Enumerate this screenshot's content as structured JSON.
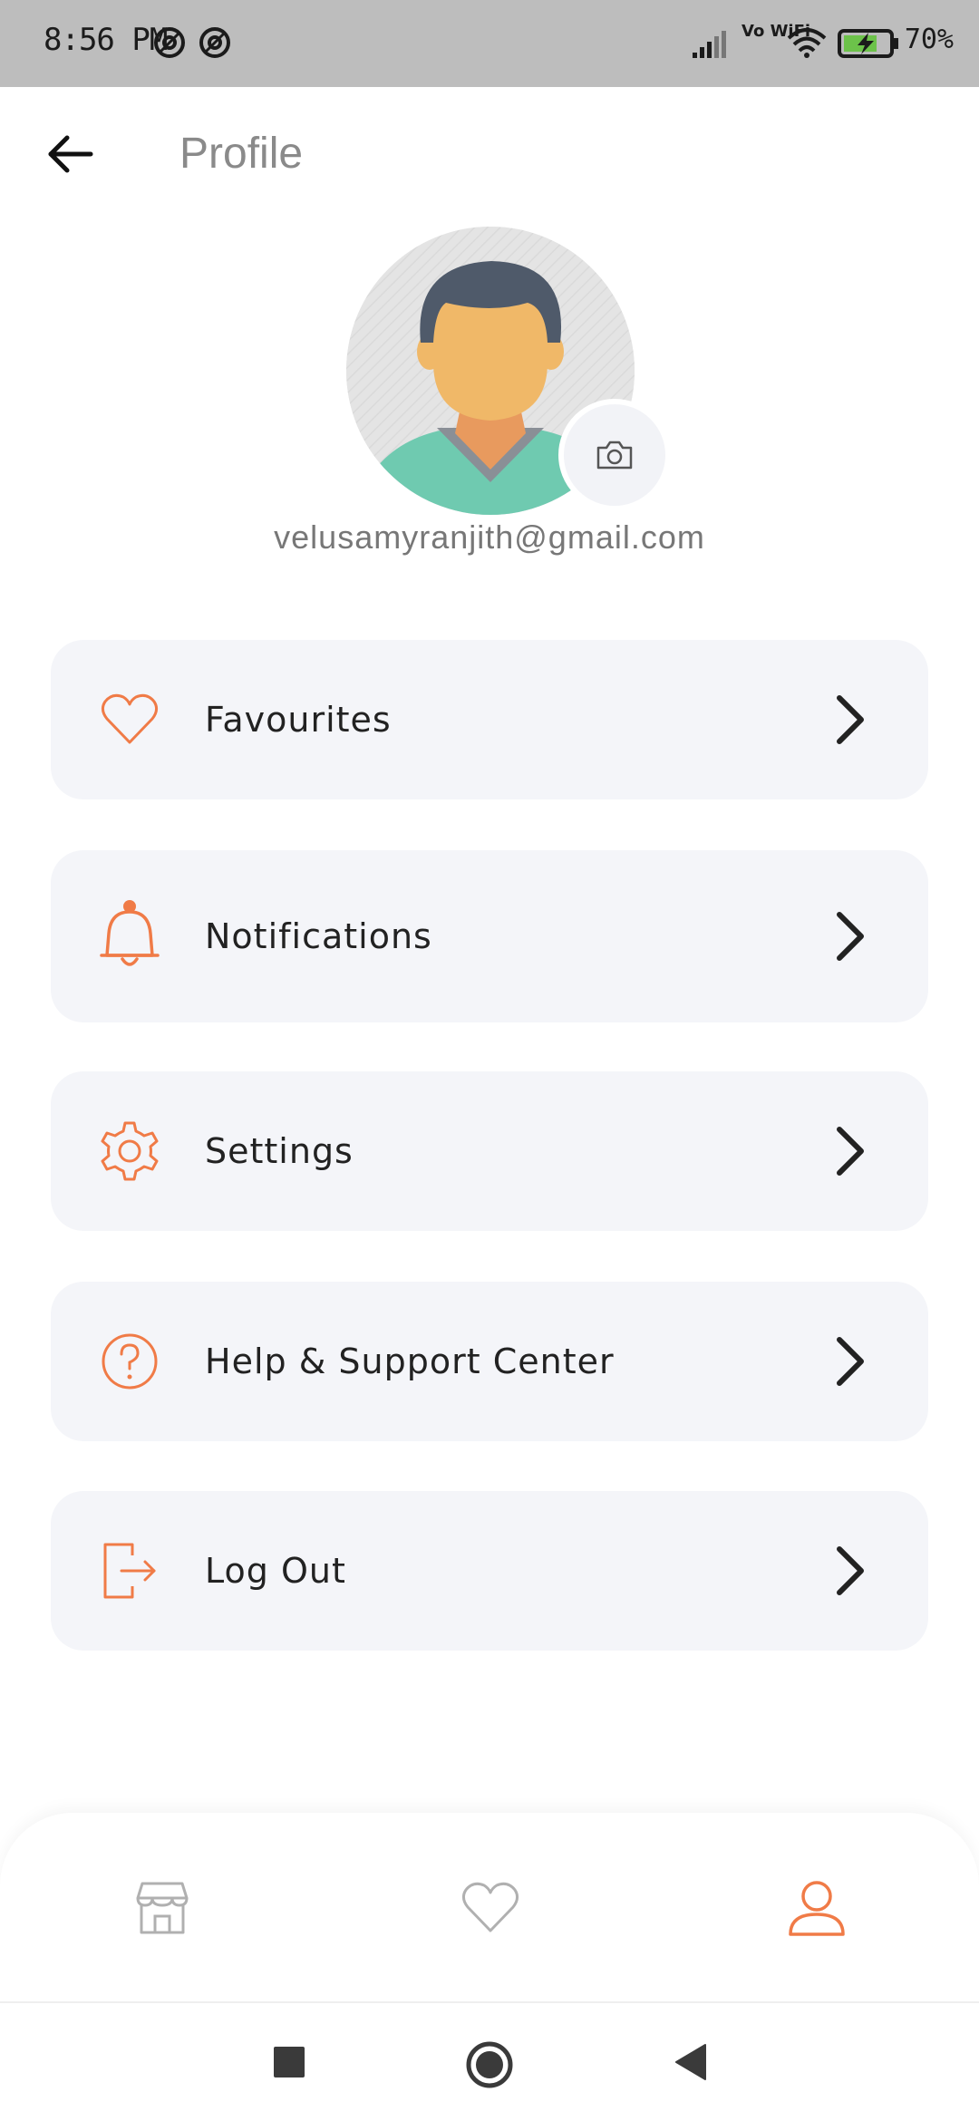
{
  "status_bar": {
    "time": "8:56 PM",
    "battery_text": "70%",
    "icons": [
      "notification-a-icon",
      "notification-b-icon",
      "signal-icon",
      "vowifi-icon",
      "wifi-icon",
      "battery-charging-icon"
    ],
    "vowifi_label": "Vo WiFi"
  },
  "header": {
    "title": "Profile",
    "back_icon": "arrow-left-icon"
  },
  "profile": {
    "email": "velusamyranjith@gmail.com",
    "camera_icon": "camera-icon"
  },
  "menu": {
    "items": [
      {
        "label": "Favourites",
        "icon": "heart-icon"
      },
      {
        "label": "Notifications",
        "icon": "bell-icon"
      },
      {
        "label": "Settings",
        "icon": "gear-icon"
      },
      {
        "label": "Help & Support Center",
        "icon": "help-circle-icon"
      },
      {
        "label": "Log Out",
        "icon": "logout-icon"
      }
    ]
  },
  "bottom_nav": {
    "items": [
      {
        "icon": "store-icon",
        "active": false
      },
      {
        "icon": "heart-icon",
        "active": false
      },
      {
        "icon": "user-icon",
        "active": true
      }
    ]
  },
  "colors": {
    "accent": "#f07b47",
    "inactive": "#b0b0b0",
    "card_bg": "#f4f5f9"
  }
}
